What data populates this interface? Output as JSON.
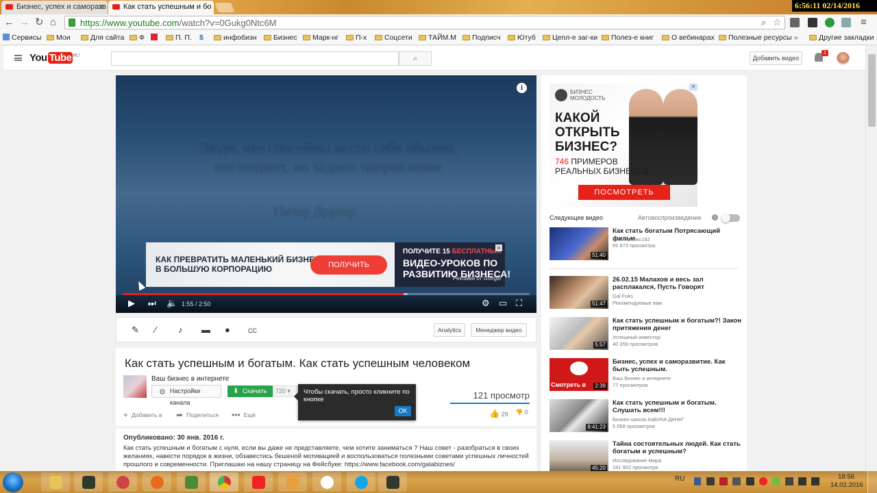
{
  "browser": {
    "tabs": [
      {
        "title": "Бизнес, успех и саморазв"
      },
      {
        "title": "Как стать успешным и бо"
      }
    ],
    "clock": "6:56:11  02/14/2016",
    "url_host": "https://www.youtube.com",
    "url_path": "/watch?v=0Gukg0Ntc6M",
    "bookmarks": [
      "Сервисы",
      "Мои",
      "Для сайта",
      "Ф",
      "П. П.",
      "инфобизн",
      "Бизнес",
      "Марк-нг",
      "П-х",
      "Соцсети",
      "ТАЙМ.М",
      "Подписч",
      "Ютуб",
      "Цепл-е заг-ки",
      "Полез-е книг",
      "О вебинарах",
      "Полезные ресурсы",
      "»",
      "Другие закладки"
    ]
  },
  "youtube": {
    "logo_you": "You",
    "logo_tube": "Tube",
    "logo_region": "RU",
    "add_video": "Добавить видео",
    "notifications": "1"
  },
  "player": {
    "overlay_text_line1": "Люди, что способны вести себя обычно,",
    "overlay_text_line2": "поглощают, но задают направление",
    "overlay_text_author": "Питер Друкер",
    "time": "1:55 / 2:50",
    "progress": 0.69,
    "ad": {
      "left_text": "КАК ПРЕВРАТИТЬ МАЛЕНЬКИЙ БИЗНЕС\nВ БОЛЬШУЮ КОРПОРАЦИЮ",
      "button": "ПОЛУЧИТЬ",
      "right_line1": "ПОЛУЧИТЕ 15",
      "right_line1_accent": "БЕСПЛАТНЫХ",
      "right_line2": "ВИДЕО-УРОКОВ ПО\nРАЗВИТИЮ БИЗНЕСА!",
      "attribution": "Реклама от Google",
      "close": "×"
    }
  },
  "creator": {
    "analytics": "Analytics",
    "manager": "Менеджер видео"
  },
  "video": {
    "title": "Как стать успешным и богатым. Как стать успешным человеком",
    "channel": "Ваш бизнес в интернете",
    "channel_settings": "Настройки канала",
    "download": "Скачать",
    "quality": "720",
    "views": "121 просмотр",
    "add_to": "Добавить в",
    "share": "Поделиться",
    "more": "Ещё",
    "likes": "29",
    "dislikes": "0",
    "tooltip": "Чтобы скачать, просто кликните по кнопке",
    "tooltip_ok": "OK",
    "published": "Опубликовано: 30 янв. 2016 г.",
    "description": "Как стать успешным и богатым с нуля, если вы даже не представляете, чем хотите заниматься ? Наш совет - разобраться в своих желаниях, навести порядок в жизни, обзавестись бешеной мотивацией и воспользоваться полезными советами успешных личностей прошлого и современности. Приглашаю на нашу страницу на Фейсбуке: https://www.facebook.com/galabiznes/"
  },
  "sidebar": {
    "ad": {
      "brand": "БИЗНЕС\nМОЛОДОСТЬ",
      "question": "КАКОЙ\nОТКРЫТЬ\nБИЗНЕС?",
      "count": "746",
      "examples": "ПРИМЕРОВ\nРЕАЛЬНЫХ БИЗНЕСОВ",
      "cta": "ПОСМОТРЕТЬ"
    },
    "next_label": "Следующее видео",
    "autoplay_label": "Автовоспроизведение",
    "videos": [
      {
        "title": "Как стать богатым Потрясающий фильм",
        "channel": "БизнесМикс192",
        "views": "55 873 просмотра",
        "duration": "51:40",
        "color": "#2a3f8a"
      },
      {
        "title": "26.02.15 Малахов и весь зал расплакался, Пусть Говорят",
        "channel": "Gal Foks",
        "views": "Рекомендуемые вам",
        "duration": "51:47",
        "color": "#7a4a3a"
      },
      {
        "title": "Как стать успешным и богатым?! Закон притяжения денег",
        "channel": "Успешный инвестор",
        "views": "40 359 просмотров",
        "duration": "5:57",
        "color": "#b8b8b8"
      },
      {
        "title": "Бизнес, успех и саморазвитие. Как быть успешным.",
        "channel": "Ваш бизнес в интернете",
        "views": "77 просмотров",
        "duration": "2:39",
        "color": "#d01818"
      },
      {
        "title": "Как стать успешным и богатым. Слушать всем!!!",
        "channel": "Бизнес-школа АаБУКА ДеНеГ",
        "views": "5 058 просмотров",
        "duration": "9:41:23",
        "color": "#9a9a9a"
      },
      {
        "title": "Тайна состоятельных людей. Как стать богатым и успешным?",
        "channel": "Исследование Мира",
        "views": "241 902 просмотра",
        "duration": "45:20",
        "color": "#c7b8a8"
      }
    ],
    "thumb_caption": "Смотреть в"
  },
  "taskbar": {
    "lang": "RU",
    "time": "18:56",
    "date": "14.02.2016"
  }
}
